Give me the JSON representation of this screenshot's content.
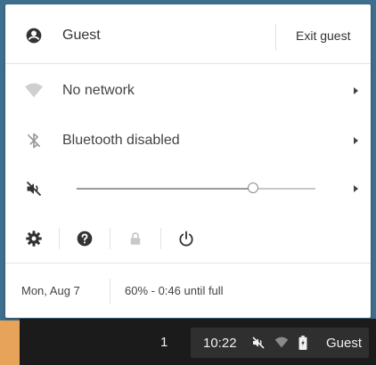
{
  "user": {
    "name": "Guest",
    "exit_label": "Exit guest"
  },
  "network": {
    "label": "No network"
  },
  "bluetooth": {
    "label": "Bluetooth disabled"
  },
  "volume": {
    "level": 0.74,
    "muted": true
  },
  "status": {
    "date": "Mon, Aug 7",
    "battery": "60% - 0:46 until full"
  },
  "shelf": {
    "count": "1",
    "time": "10:22",
    "user": "Guest"
  },
  "icons": {
    "user": "account-circle-icon",
    "network": "wifi-icon",
    "bluetooth": "bluetooth-disabled-icon",
    "volume": "volume-muted-icon",
    "settings": "gear-icon",
    "help": "help-icon",
    "lock": "lock-icon",
    "power": "power-icon"
  }
}
